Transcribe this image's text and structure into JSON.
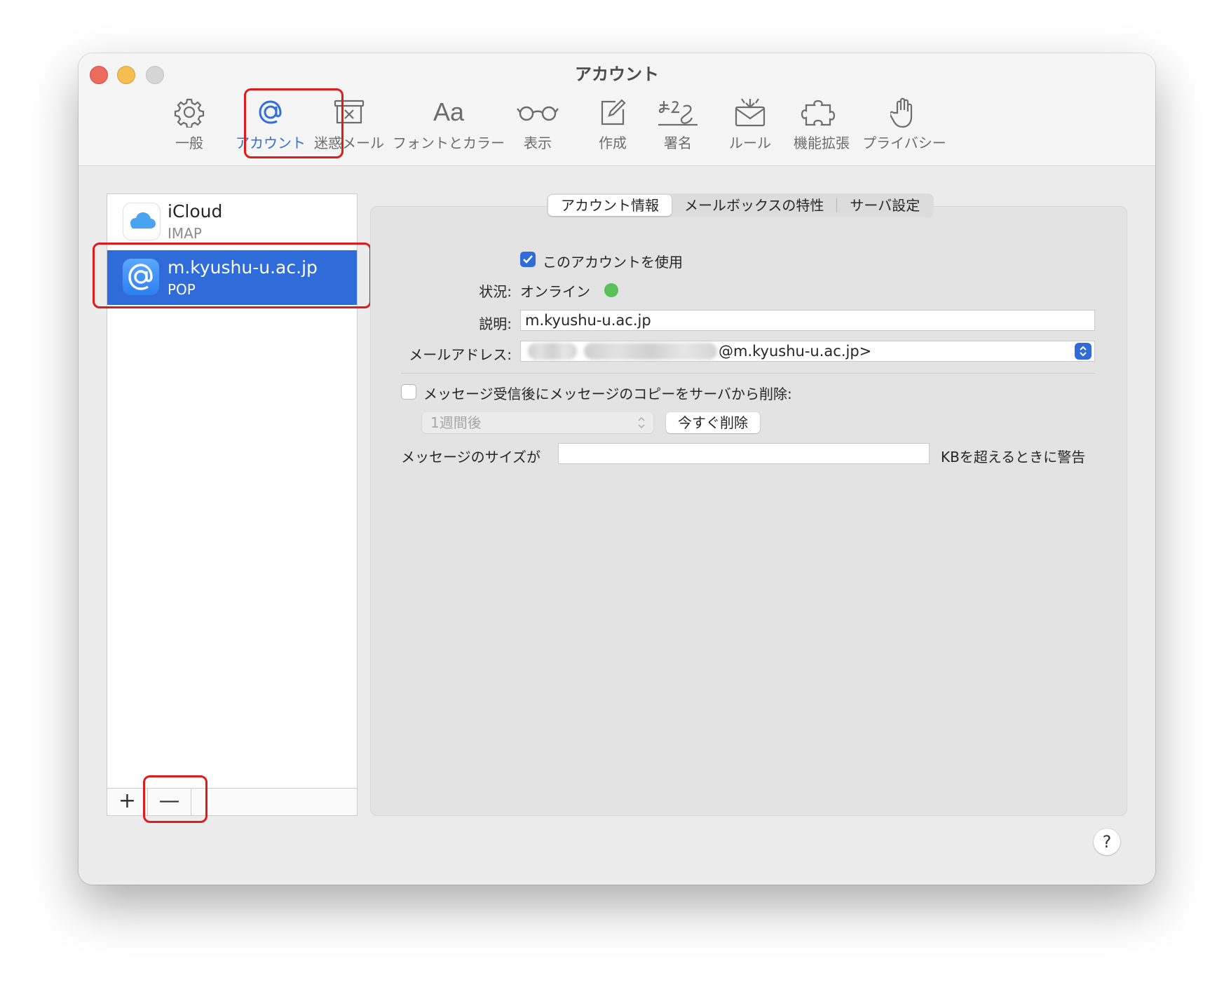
{
  "window": {
    "title": "アカウント"
  },
  "toolbar": {
    "items": [
      {
        "label": "一般",
        "icon": "gear-icon"
      },
      {
        "label": "アカウント",
        "icon": "at-sign-icon"
      },
      {
        "label": "迷惑メール",
        "icon": "junk-tray-icon"
      },
      {
        "label": "フォントとカラー",
        "icon": "fonts-icon",
        "glyph": "Aa"
      },
      {
        "label": "表示",
        "icon": "glasses-icon"
      },
      {
        "label": "作成",
        "icon": "compose-icon"
      },
      {
        "label": "署名",
        "icon": "signature-icon"
      },
      {
        "label": "ルール",
        "icon": "rules-envelope-icon"
      },
      {
        "label": "機能拡張",
        "icon": "puzzle-icon"
      },
      {
        "label": "プライバシー",
        "icon": "hand-icon"
      }
    ]
  },
  "accounts": [
    {
      "name": "iCloud",
      "type": "IMAP",
      "icon": "icloud-icon"
    },
    {
      "name": "m.kyushu-u.ac.jp",
      "type": "POP",
      "icon": "at-sign-icon"
    }
  ],
  "sidebar_buttons": {
    "add": "+",
    "remove": "—"
  },
  "tabs": [
    "アカウント情報",
    "メールボックスの特性",
    "サーバ設定"
  ],
  "form": {
    "use_account_label": "このアカウントを使用",
    "use_account_checked": true,
    "status_label": "状況:",
    "status_value": "オンライン",
    "status_color": "#5ac05a",
    "description_label": "説明:",
    "description_value": "m.kyushu-u.ac.jp",
    "email_label": "メールアドレス:",
    "email_value_visible": "@m.kyushu-u.ac.jp>",
    "delete_copy_label": "メッセージ受信後にメッセージのコピーをサーバから削除:",
    "delete_copy_checked": false,
    "delete_after_value": "1週間後",
    "delete_now_label": "今すぐ削除",
    "size_warn_prefix": "メッセージのサイズが",
    "size_warn_value": "",
    "size_warn_suffix": "KBを超えるときに警告"
  },
  "help_label": "?",
  "colors": {
    "accent": "#2f6bd9",
    "highlight": "#e01b1b"
  }
}
